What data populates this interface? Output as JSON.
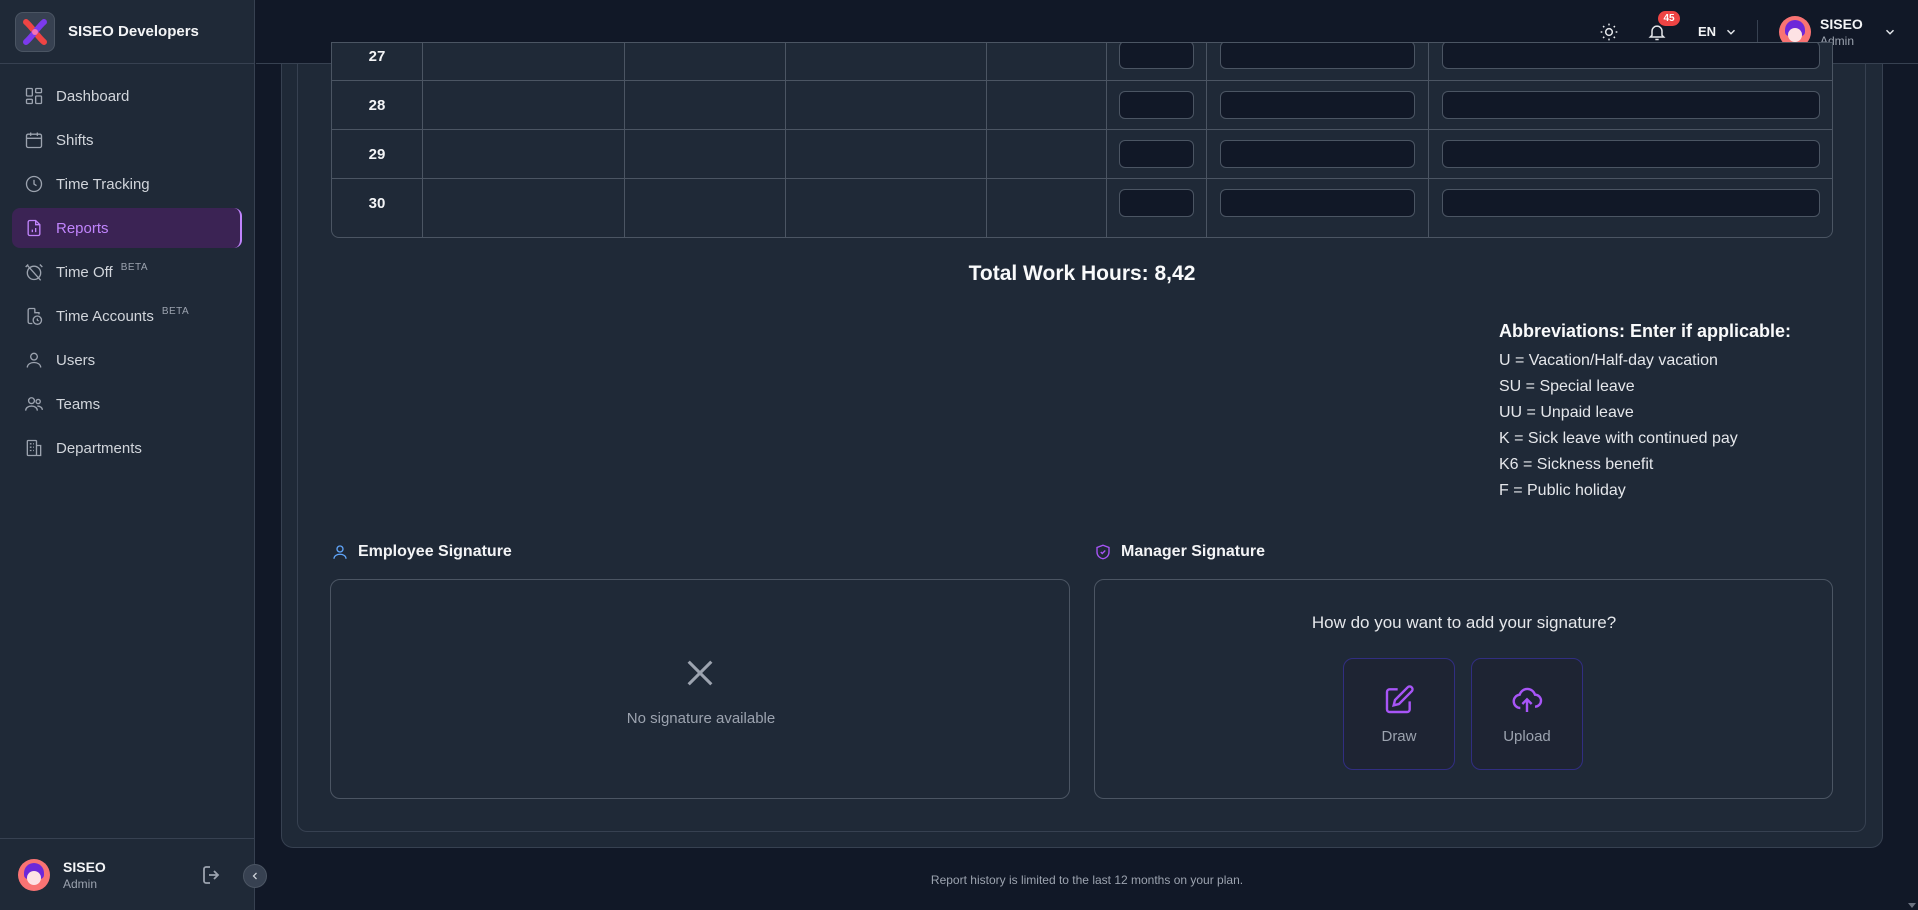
{
  "brand": {
    "name": "SISEO Developers"
  },
  "sidebar": {
    "items": [
      {
        "label": "Dashboard",
        "icon": "dashboard-icon"
      },
      {
        "label": "Shifts",
        "icon": "calendar-icon"
      },
      {
        "label": "Time Tracking",
        "icon": "clock-icon"
      },
      {
        "label": "Reports",
        "icon": "file-chart-icon",
        "active": true
      },
      {
        "label": "Time Off",
        "icon": "alarm-off-icon",
        "badge": "BETA"
      },
      {
        "label": "Time Accounts",
        "icon": "clock-file-icon",
        "badge": "BETA"
      },
      {
        "label": "Users",
        "icon": "user-icon"
      },
      {
        "label": "Teams",
        "icon": "users-icon"
      },
      {
        "label": "Departments",
        "icon": "building-icon"
      }
    ],
    "footer": {
      "name": "SISEO",
      "role": "Admin"
    }
  },
  "topbar": {
    "notifications_count": "45",
    "language": "EN",
    "user": {
      "name": "SISEO",
      "role": "Admin"
    }
  },
  "table": {
    "rows": [
      {
        "day": "27"
      },
      {
        "day": "28"
      },
      {
        "day": "29"
      },
      {
        "day": "30"
      }
    ]
  },
  "total": {
    "text": "Total Work Hours: 8,42"
  },
  "abbreviations": {
    "title": "Abbreviations: Enter if applicable:",
    "items": [
      "U = Vacation/Half-day vacation",
      "SU = Special leave",
      "UU = Unpaid leave",
      "K = Sick leave with continued pay",
      "K6 = Sickness benefit",
      "F = Public holiday"
    ]
  },
  "employee_signature": {
    "title": "Employee Signature",
    "empty_text": "No signature available"
  },
  "manager_signature": {
    "title": "Manager Signature",
    "question": "How do you want to add your signature?",
    "draw_label": "Draw",
    "upload_label": "Upload"
  },
  "footnote": "Report history is limited to the last 12 months on your plan.",
  "colors": {
    "accent": "#c084fc",
    "badge": "#ef4444",
    "background": "#111827",
    "panel": "#1f2937"
  }
}
